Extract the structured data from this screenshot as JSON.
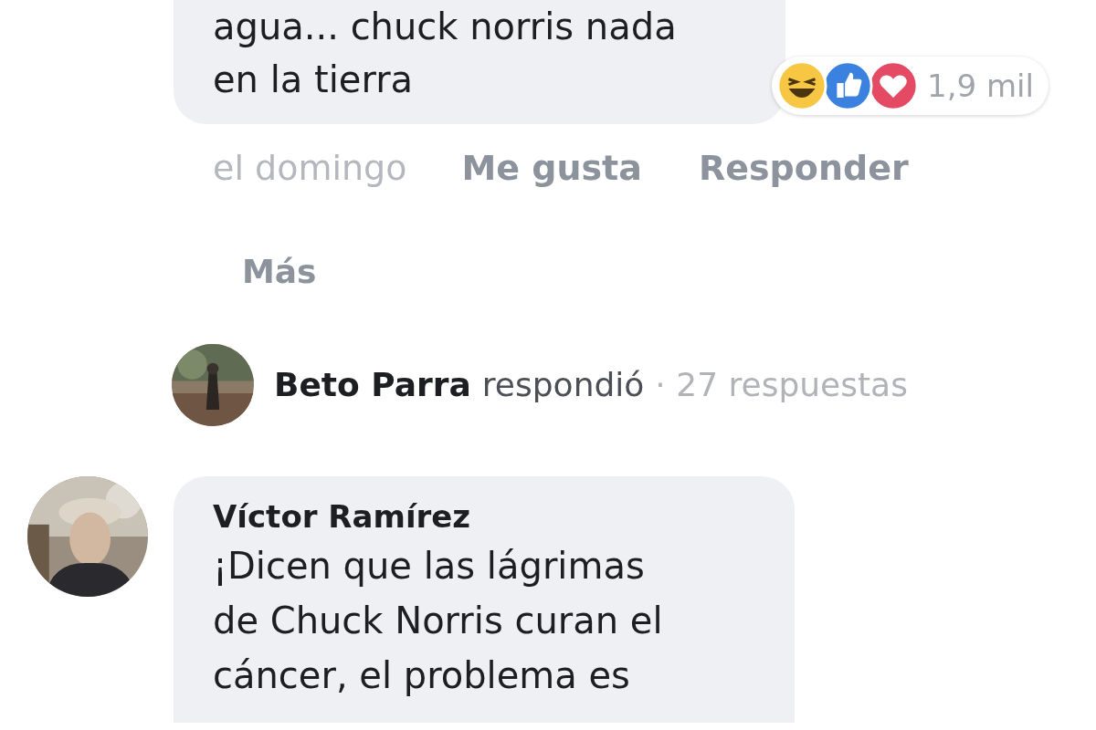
{
  "first_comment": {
    "text": "agua... chuck norris nada\nen la tierra",
    "reactions": [
      {
        "kind": "haha"
      },
      {
        "kind": "like"
      },
      {
        "kind": "love"
      }
    ],
    "reaction_count": "1,9 mil",
    "time": "el domingo",
    "actions": [
      "Me gusta",
      "Responder"
    ]
  },
  "more_link": "Más",
  "reply_summary": {
    "author": "Beto Parra",
    "verb": "respondió",
    "count": "· 27 respuestas"
  },
  "second_comment": {
    "author": "Víctor Ramírez",
    "text": "¡Dicen que las lágrimas\nde Chuck Norris curan el\ncáncer, el problema es"
  }
}
